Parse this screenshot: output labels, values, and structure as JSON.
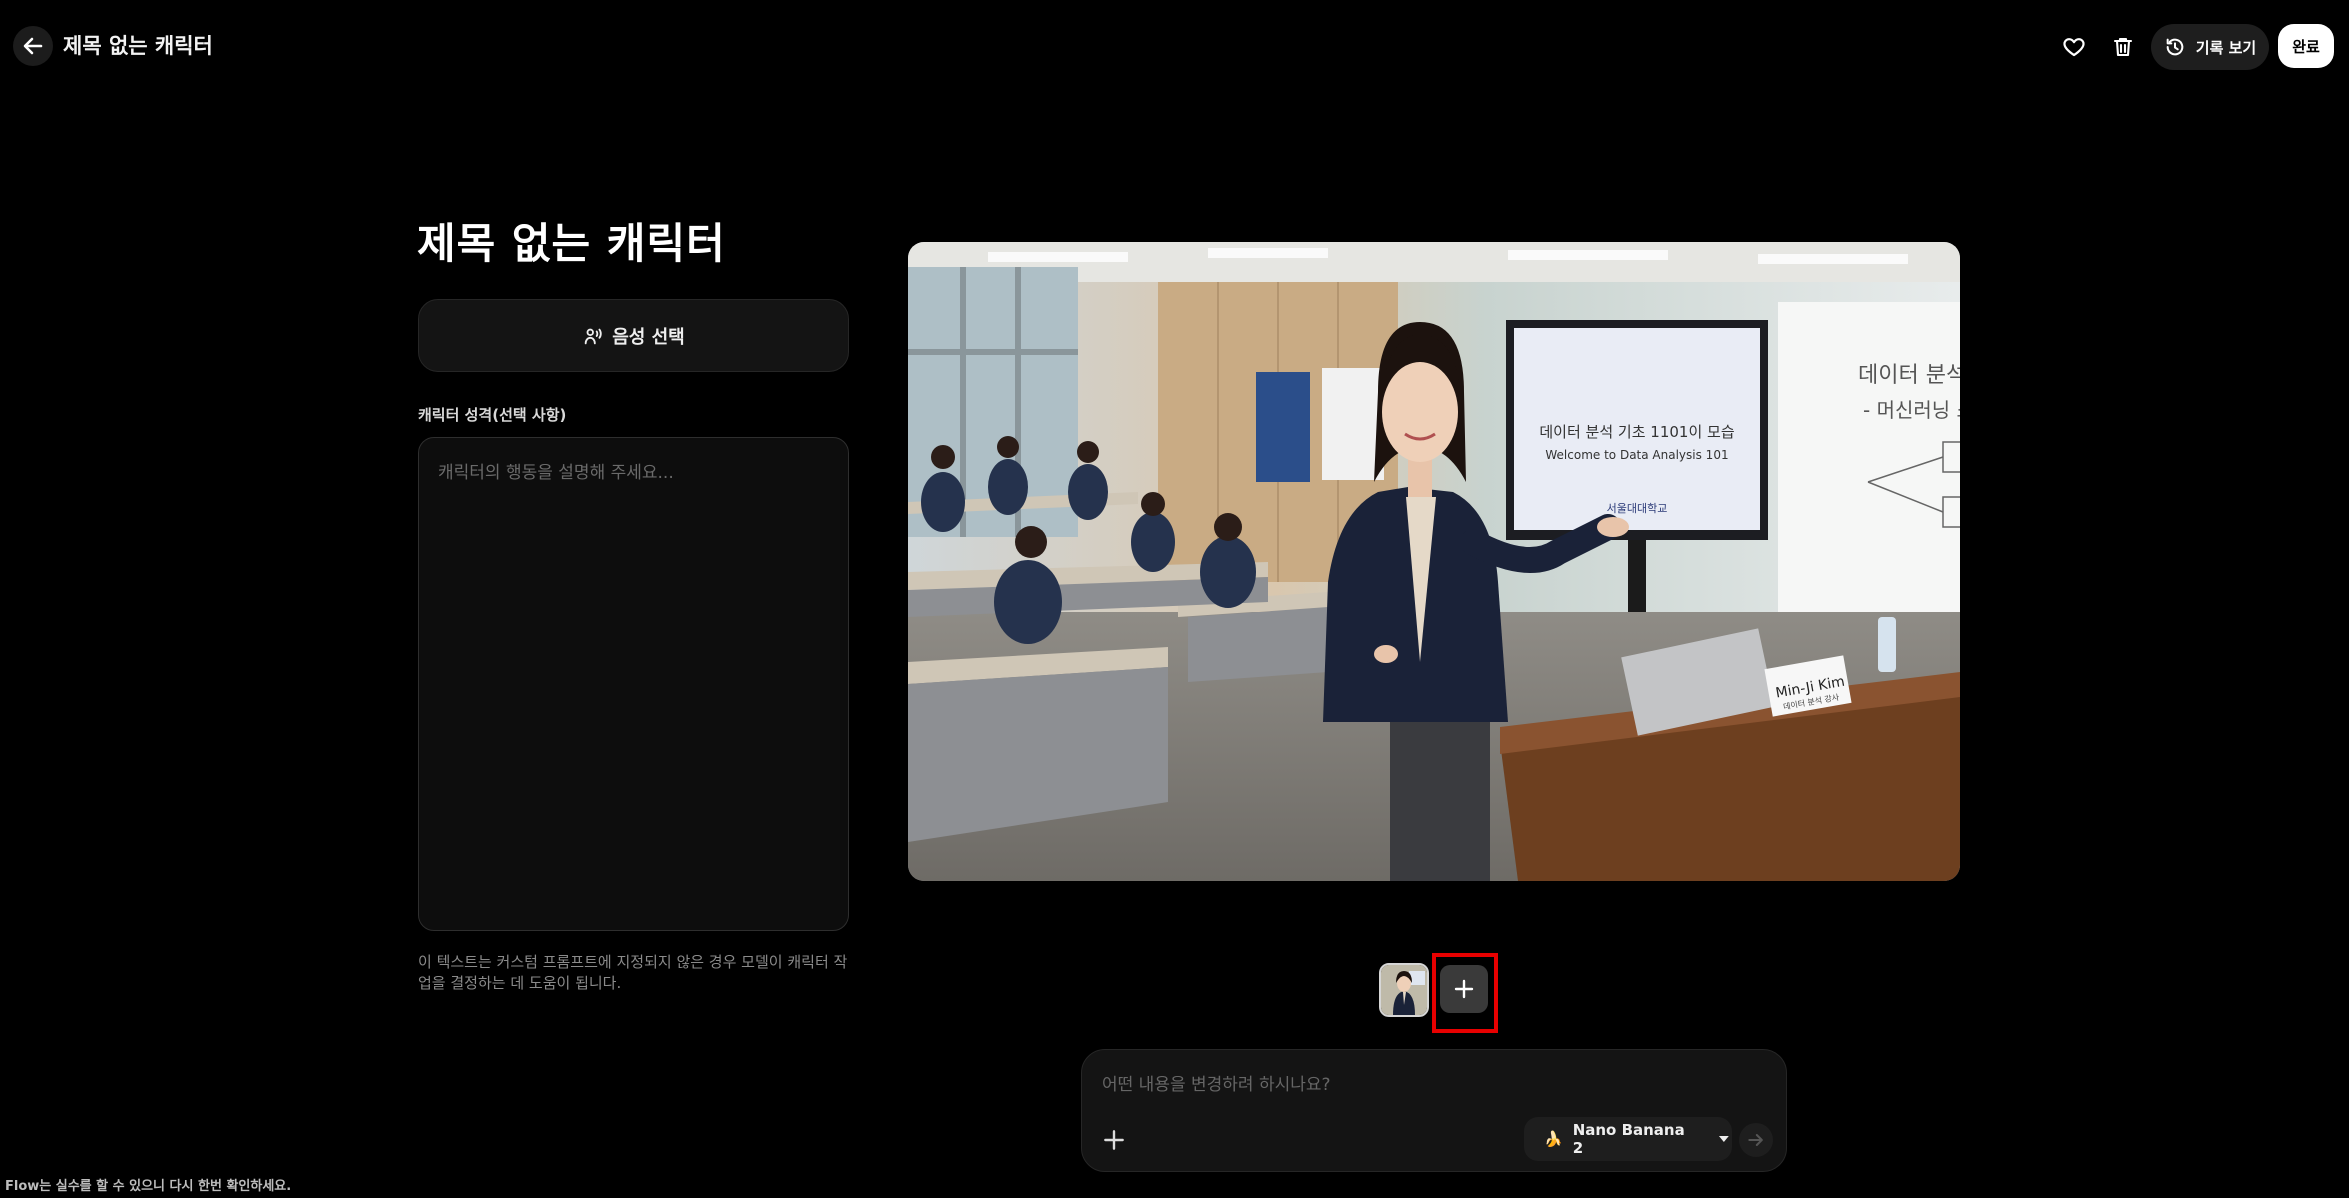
{
  "header": {
    "title": "제목 없는 캐릭터",
    "history_label": "기록 보기",
    "done_label": "완료",
    "icons": {
      "back": "arrow-left-icon",
      "favorite": "heart-icon",
      "delete": "trash-icon",
      "history": "history-icon"
    }
  },
  "character": {
    "title": "제목 없는 캐릭터",
    "voice_button_label": "음성 선택",
    "persona_label": "캐릭터 성격(선택 사항)",
    "persona_placeholder": "캐릭터의 행동을 설명해 주세요...",
    "persona_value": "",
    "help_text": "이 텍스트는 커스텀 프롬프트에 지정되지 않은 경우 모델이 캐릭터 작업을 결정하는 데 도움이 됩니다."
  },
  "image": {
    "screen_title_ko": "데이터 분석 기초 1101이 모습",
    "screen_title_en": "Welcome to Data Analysis 101",
    "screen_org": "서울대대학교",
    "whiteboard_line1": "데이터 분석 기",
    "whiteboard_line2": "- 머신러닝 소개",
    "nameplate_name": "Min-Ji Kim",
    "nameplate_role": "데이터 분석 강사"
  },
  "prompt": {
    "placeholder": "어떤 내용을 변경하려 하시나요?",
    "value": "",
    "model_emoji": "🍌",
    "model_label": "Nano Banana 2"
  },
  "footer": {
    "disclaimer": "Flow는 실수를 할 수 있으니 다시 한번 확인하세요."
  },
  "colors": {
    "background": "#000000",
    "highlight": "#e80000",
    "panel": "#141414"
  }
}
